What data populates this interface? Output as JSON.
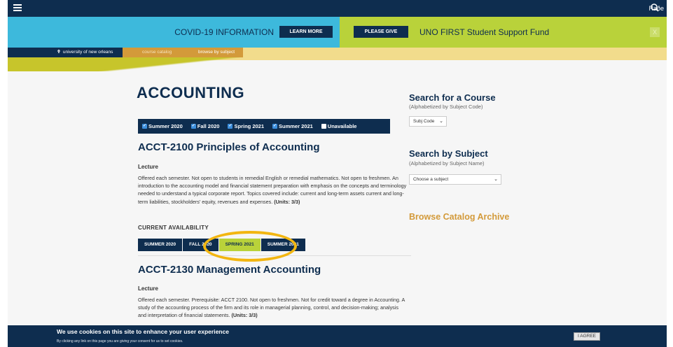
{
  "topbar": {
    "search_label": "Raðe"
  },
  "banner": {
    "covid_text": "COVID-19 INFORMATION",
    "learn_more": "LEARN MORE",
    "please_give": "PLEASE GIVE",
    "fund_text": "UNO FIRST Student Support Fund",
    "close": "X"
  },
  "breadcrumb": {
    "home": "university of new orleans",
    "catalog": "course catalog",
    "browse": "browse by subject"
  },
  "page": {
    "title": "ACCOUNTING"
  },
  "filters": [
    {
      "label": "Summer 2020",
      "checked": true
    },
    {
      "label": "Fall 2020",
      "checked": true
    },
    {
      "label": "Spring 2021",
      "checked": true
    },
    {
      "label": "Summer 2021",
      "checked": true
    },
    {
      "label": "Unavailable",
      "checked": false
    }
  ],
  "courses": [
    {
      "title": "ACCT-2100 Principles of Accounting",
      "type": "Lecture",
      "description": "Offered each semester. Not open to students in remedial English or remedial mathematics. Not open to freshmen. An introduction to the accounting model and financial statement preparation with emphasis on the concepts and terminology needed to understand a typical corporate report. Topics covered include: current and long-term assets current and long-term liabilities, stockholders' equity, revenues and expenses.",
      "units": "(Units: 3/3)",
      "availability_label": "CURRENT AVAILABILITY",
      "availability": [
        "SUMMER 2020",
        "FALL 2020",
        "SPRING 2021",
        "SUMMER 2021"
      ],
      "active_term": "SPRING 2021"
    },
    {
      "title": "ACCT-2130 Management Accounting",
      "type": "Lecture",
      "description": "Offered each semester. Prerequisite: ACCT 2100. Not open to freshmen. Not for credit toward a degree in Accounting. A study of the accounting process of the firm and its role in managerial planning, control, and decision-making; analysis and interpretation of financial statements.",
      "units": "(Units: 3/3)"
    }
  ],
  "sidebar": {
    "search_course": "Search for a Course",
    "search_course_sub": "(Alphabetized by Subject Code)",
    "subj_code_value": "Subj Code",
    "search_subject": "Search by Subject",
    "search_subject_sub": "(Alphabetized by Subject Name)",
    "subject_value": "Choose a subject",
    "archive": "Browse Catalog Archive"
  },
  "cookie": {
    "title": "We use cookies on this site to enhance your user experience",
    "sub": "By clicking any link on this page you are giving your consent for us to set cookies.",
    "agree": "I AGREE"
  },
  "colors": {
    "navy": "#0e2d4f",
    "banner_blue": "#3db9dc",
    "banner_green": "#b9d23a",
    "gold": "#d39a3a",
    "annotation": "#f2b611"
  }
}
